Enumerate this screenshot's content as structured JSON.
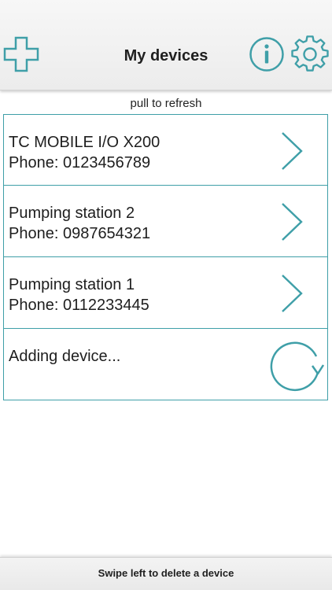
{
  "header": {
    "title": "My devices",
    "add_icon": "plus-icon",
    "info_icon": "info-icon",
    "settings_icon": "gear-icon"
  },
  "pull_hint": "pull to refresh",
  "devices": [
    {
      "name": "TC MOBILE I/O X200",
      "phone": "Phone: 0123456789"
    },
    {
      "name": "Pumping station 2",
      "phone": "Phone: 0987654321"
    },
    {
      "name": "Pumping station 1",
      "phone": "Phone: 0112233445"
    }
  ],
  "adding_row": {
    "label": "Adding device...",
    "icon": "refresh-icon"
  },
  "footer": {
    "hint": "Swipe left to delete a device"
  },
  "colors": {
    "accent": "#3f9fa8",
    "header_bg": "#f2f2f2",
    "text": "#1e1e1e"
  }
}
